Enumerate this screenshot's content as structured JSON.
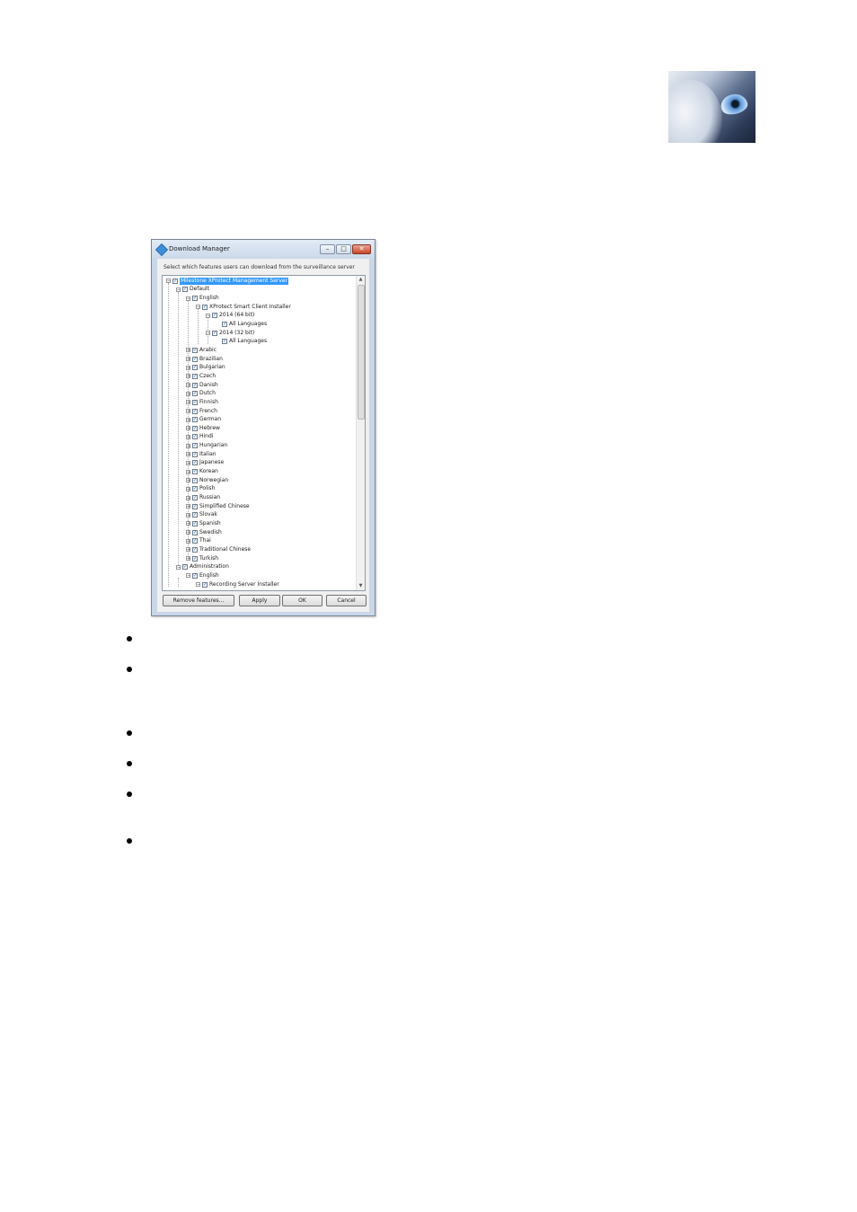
{
  "window": {
    "title": "Download Manager",
    "instruction": "Select which features users can download from the surveillance server",
    "titlebar_buttons": {
      "minimize": "–",
      "maximize": "□",
      "close": "✕"
    }
  },
  "tree": {
    "expander_collapse": "⊟",
    "expander_expand": "⊞",
    "check": "✓",
    "nodes": [
      {
        "label": "Milestone XProtect Management Server",
        "level": 0,
        "expander": "minus",
        "selected": true
      },
      {
        "label": "Default",
        "level": 1,
        "expander": "minus"
      },
      {
        "label": "English",
        "level": 2,
        "expander": "minus"
      },
      {
        "label": "XProtect Smart Client Installer",
        "level": 3,
        "expander": "minus"
      },
      {
        "label": "2014 (64 bit)",
        "level": 4,
        "expander": "minus"
      },
      {
        "label": "All Languages",
        "level": 5,
        "expander": "none"
      },
      {
        "label": "2014 (32 bit)",
        "level": 4,
        "expander": "minus"
      },
      {
        "label": "All Languages",
        "level": 5,
        "expander": "none"
      },
      {
        "label": "Arabic",
        "level": 2,
        "expander": "plus"
      },
      {
        "label": "Brazilian",
        "level": 2,
        "expander": "plus"
      },
      {
        "label": "Bulgarian",
        "level": 2,
        "expander": "plus"
      },
      {
        "label": "Czech",
        "level": 2,
        "expander": "plus"
      },
      {
        "label": "Danish",
        "level": 2,
        "expander": "plus"
      },
      {
        "label": "Dutch",
        "level": 2,
        "expander": "plus"
      },
      {
        "label": "Finnish",
        "level": 2,
        "expander": "plus"
      },
      {
        "label": "French",
        "level": 2,
        "expander": "plus"
      },
      {
        "label": "German",
        "level": 2,
        "expander": "plus"
      },
      {
        "label": "Hebrew",
        "level": 2,
        "expander": "plus"
      },
      {
        "label": "Hindi",
        "level": 2,
        "expander": "plus"
      },
      {
        "label": "Hungarian",
        "level": 2,
        "expander": "plus"
      },
      {
        "label": "Italian",
        "level": 2,
        "expander": "plus"
      },
      {
        "label": "Japanese",
        "level": 2,
        "expander": "plus"
      },
      {
        "label": "Korean",
        "level": 2,
        "expander": "plus"
      },
      {
        "label": "Norwegian",
        "level": 2,
        "expander": "plus"
      },
      {
        "label": "Polish",
        "level": 2,
        "expander": "plus"
      },
      {
        "label": "Russian",
        "level": 2,
        "expander": "plus"
      },
      {
        "label": "Simplified Chinese",
        "level": 2,
        "expander": "plus"
      },
      {
        "label": "Slovak",
        "level": 2,
        "expander": "plus"
      },
      {
        "label": "Spanish",
        "level": 2,
        "expander": "plus"
      },
      {
        "label": "Swedish",
        "level": 2,
        "expander": "plus"
      },
      {
        "label": "Thai",
        "level": 2,
        "expander": "plus"
      },
      {
        "label": "Traditional Chinese",
        "level": 2,
        "expander": "plus"
      },
      {
        "label": "Turkish",
        "level": 2,
        "expander": "plus"
      },
      {
        "label": "Administration",
        "level": 1,
        "expander": "minus"
      },
      {
        "label": "English",
        "level": 2,
        "expander": "minus"
      },
      {
        "label": "Recording Server Installer",
        "level": 3,
        "expander": "minus"
      }
    ]
  },
  "scrollbar": {
    "up": "▲",
    "down": "▼"
  },
  "buttons": {
    "remove_features": "Remove features...",
    "apply": "Apply",
    "ok": "OK",
    "cancel": "Cancel"
  }
}
